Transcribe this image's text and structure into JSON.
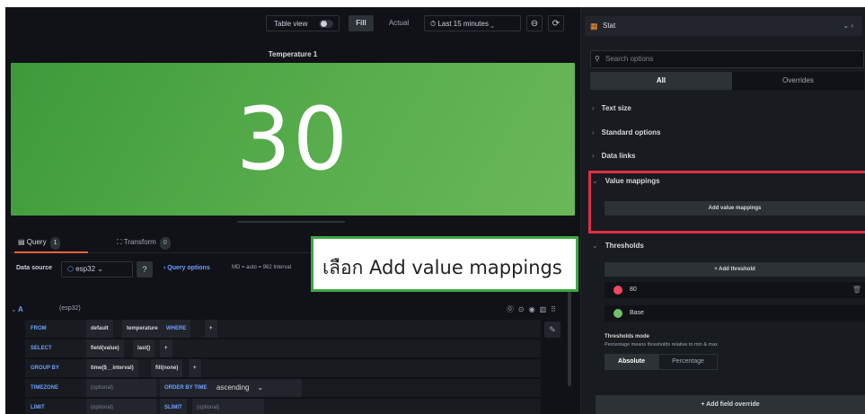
{
  "toolbar": {
    "table_view": "Table view",
    "fill": "Fill",
    "actual": "Actual",
    "time_range": "⏱ Last 15 minutes ⌄",
    "zoom_icon": "⊖",
    "refresh_icon": "⟳"
  },
  "panel": {
    "title": "Temperature 1",
    "value": "30",
    "color": "#56a64b"
  },
  "query_tabs": {
    "query_label": "Query",
    "query_count": "1",
    "transform_label": "Transform",
    "transform_count": "0"
  },
  "datasource": {
    "label": "Data source",
    "value": "esp32",
    "query_options": "Query options",
    "meta": "MD = auto = 962   Interval"
  },
  "query": {
    "ref": "A",
    "source": "(esp32)",
    "rows": [
      {
        "keyword": "FROM",
        "parts": [
          "default",
          "temperature"
        ],
        "extra_kw": "WHERE",
        "plus": "+"
      },
      {
        "keyword": "SELECT",
        "parts": [
          "field(value)",
          "last()"
        ],
        "plus": "+"
      },
      {
        "keyword": "GROUP BY",
        "parts": [
          "time($__interval)",
          "fill(none)"
        ],
        "plus": "+"
      },
      {
        "keyword": "TIMEZONE",
        "placeholder": "(optional)",
        "extra_kw": "ORDER BY TIME",
        "value": "ascending"
      },
      {
        "keyword": "LIMIT",
        "placeholder": "(optional)",
        "extra_kw": "SLIMIT",
        "placeholder2": "(optional)"
      }
    ]
  },
  "callout": {
    "text": "เลือก Add value mappings"
  },
  "options": {
    "viz_name": "Stat",
    "search_placeholder": "Search options",
    "tab_all": "All",
    "tab_overrides": "Overrides",
    "sections": [
      "Text size",
      "Standard options",
      "Data links",
      "Value mappings"
    ],
    "add_value_mappings": "Add value mappings",
    "thresholds_title": "Thresholds",
    "add_threshold": "+ Add threshold",
    "thresholds": [
      {
        "label": "80",
        "color": "#f2495c"
      },
      {
        "label": "Base",
        "color": "#73bf69"
      }
    ],
    "threshold_mode_title": "Thresholds mode",
    "threshold_mode_desc": "Percentage means thresholds relative to min & max",
    "mode_absolute": "Absolute",
    "mode_percentage": "Percentage",
    "add_field_override": "+ Add field override"
  }
}
